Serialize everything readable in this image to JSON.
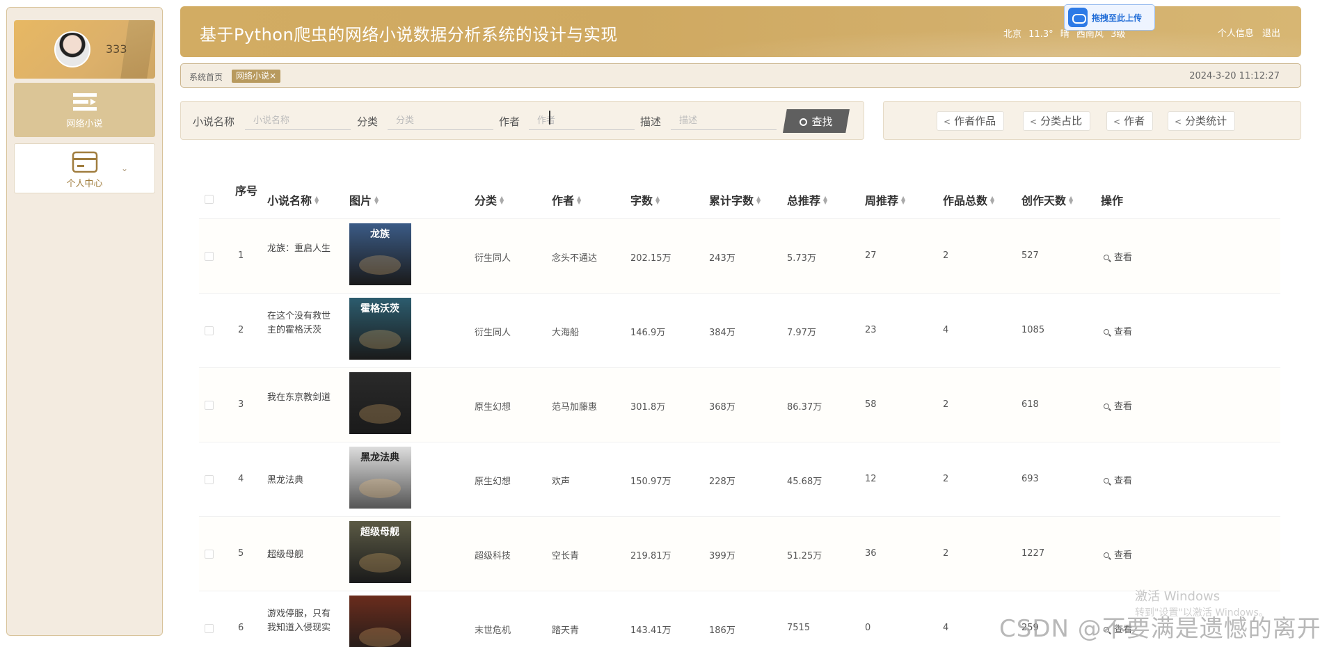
{
  "sidebar": {
    "username": "333",
    "items": [
      {
        "label": "网络小说"
      },
      {
        "label": "个人中心"
      }
    ]
  },
  "header": {
    "title": "基于Python爬虫的网络小说数据分析系统的设计与实现",
    "weather": {
      "city": "北京",
      "temp": "11.3°",
      "cond": "晴",
      "wind": "西南风",
      "level": "3级"
    },
    "links": {
      "profile": "个人信息",
      "logout": "退出"
    },
    "upload_badge": "拖拽至此上传"
  },
  "crumbs": {
    "home": "系统首页",
    "tag": "网络小说×",
    "time": "2024-3-20 11:12:27"
  },
  "search": {
    "fields": [
      {
        "label": "小说名称",
        "placeholder": "小说名称"
      },
      {
        "label": "分类",
        "placeholder": "分类"
      },
      {
        "label": "作者",
        "placeholder": "作者"
      },
      {
        "label": "描述",
        "placeholder": "描述"
      }
    ],
    "button": "查找"
  },
  "chart_buttons": [
    "作者作品",
    "分类占比",
    "作者",
    "分类统计"
  ],
  "table": {
    "headers": {
      "seq": "序号",
      "name": "小说名称",
      "image": "图片",
      "category": "分类",
      "author": "作者",
      "words": "字数",
      "total_words": "累计字数",
      "total_rec": "总推荐",
      "week_rec": "周推荐",
      "works": "作品总数",
      "days": "创作天数",
      "action": "操作"
    },
    "rows": [
      {
        "seq": "1",
        "name": "龙族：重启人生",
        "category": "衍生同人",
        "author": "念头不通达",
        "words": "202.15万",
        "total_words": "243万",
        "total_rec": "5.73万",
        "week_rec": "27",
        "works": "2",
        "days": "527",
        "action": "查看",
        "cover_text": "龙族",
        "cover_color": "#3b5b86"
      },
      {
        "seq": "2",
        "name": "在这个没有救世主的霍格沃茨",
        "category": "衍生同人",
        "author": "大海船",
        "words": "146.9万",
        "total_words": "384万",
        "total_rec": "7.97万",
        "week_rec": "23",
        "works": "4",
        "days": "1085",
        "action": "查看",
        "cover_text": "霍格沃茨",
        "cover_color": "#2c5c6e"
      },
      {
        "seq": "3",
        "name": "我在东京教剑道",
        "category": "原生幻想",
        "author": "范马加藤惠",
        "words": "301.8万",
        "total_words": "368万",
        "total_rec": "86.37万",
        "week_rec": "58",
        "works": "2",
        "days": "618",
        "action": "查看",
        "cover_text": "",
        "cover_color": "#2a2a2a"
      },
      {
        "seq": "4",
        "name": "黑龙法典",
        "category": "原生幻想",
        "author": "欢声",
        "words": "150.97万",
        "total_words": "228万",
        "total_rec": "45.68万",
        "week_rec": "12",
        "works": "2",
        "days": "693",
        "action": "查看",
        "cover_text": "黑龙法典",
        "cover_color": "#dddddd"
      },
      {
        "seq": "5",
        "name": "超级母舰",
        "category": "超级科技",
        "author": "空长青",
        "words": "219.81万",
        "total_words": "399万",
        "total_rec": "51.25万",
        "week_rec": "36",
        "works": "2",
        "days": "1227",
        "action": "查看",
        "cover_text": "超级母舰",
        "cover_color": "#5b5a45"
      },
      {
        "seq": "6",
        "name": "游戏停服，只有我知道入侵现实",
        "category": "末世危机",
        "author": "踏天青",
        "words": "143.41万",
        "total_words": "186万",
        "total_rec": "7515",
        "week_rec": "0",
        "works": "4",
        "days": "259",
        "action": "查看",
        "cover_text": "",
        "cover_color": "#6a2c1c"
      }
    ]
  },
  "watermarks": {
    "windows": "激活 Windows",
    "windows_sub": "转到\"设置\"以激活 Windows。",
    "csdn": "CSDN @不要满是遗憾的离开"
  },
  "colors": {
    "brand": "#d2ac63",
    "sidebar_bg": "#f3ebe0",
    "tag": "#b89a5e",
    "button": "#5f5f5f"
  }
}
